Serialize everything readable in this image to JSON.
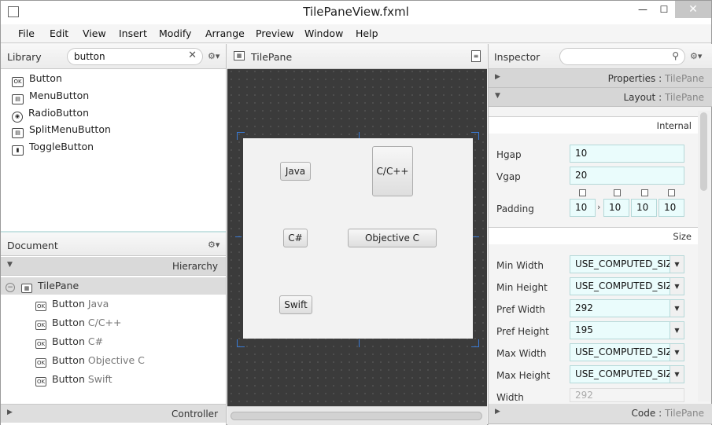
{
  "window": {
    "title": "TilePaneView.fxml",
    "min": "—",
    "max": "☐",
    "close": "✕"
  },
  "menu": [
    "File",
    "Edit",
    "View",
    "Insert",
    "Modify",
    "Arrange",
    "Preview",
    "Window",
    "Help"
  ],
  "library": {
    "title": "Library",
    "search_value": "button",
    "items": [
      {
        "icon": "OK",
        "label": "Button"
      },
      {
        "icon": "▤",
        "label": "MenuButton"
      },
      {
        "icon": "◉",
        "label": "RadioButton"
      },
      {
        "icon": "▤",
        "label": "SplitMenuButton"
      },
      {
        "icon": "▮",
        "label": "ToggleButton"
      }
    ]
  },
  "document": {
    "title": "Document",
    "hierarchy_label": "Hierarchy",
    "root": "TilePane",
    "children": [
      {
        "type": "Button",
        "text": "Java"
      },
      {
        "type": "Button",
        "text": "C/C++"
      },
      {
        "type": "Button",
        "text": "C#"
      },
      {
        "type": "Button",
        "text": "Objective C"
      },
      {
        "type": "Button",
        "text": "Swift"
      }
    ],
    "controller_label": "Controller"
  },
  "canvas": {
    "header": "TilePane",
    "buttons": {
      "java": "Java",
      "cpp": "C/C++",
      "cs": "C#",
      "objc": "Objective C",
      "swift": "Swift"
    }
  },
  "inspector": {
    "title": "Inspector",
    "search_placeholder": "",
    "properties": {
      "name": "Properties",
      "target": "TilePane"
    },
    "layout": {
      "name": "Layout",
      "target": "TilePane"
    },
    "code": {
      "name": "Code",
      "target": "TilePane"
    },
    "internal_label": "Internal",
    "size_label": "Size",
    "hgap": {
      "label": "Hgap",
      "value": "10"
    },
    "vgap": {
      "label": "Vgap",
      "value": "20"
    },
    "padding": {
      "label": "Padding",
      "values": [
        "10",
        "10",
        "10",
        "10"
      ]
    },
    "min_width": {
      "label": "Min Width",
      "value": "USE_COMPUTED_SIZE"
    },
    "min_height": {
      "label": "Min Height",
      "value": "USE_COMPUTED_SIZE"
    },
    "pref_width": {
      "label": "Pref Width",
      "value": "292"
    },
    "pref_height": {
      "label": "Pref Height",
      "value": "195"
    },
    "max_width": {
      "label": "Max Width",
      "value": "USE_COMPUTED_SIZE"
    },
    "max_height": {
      "label": "Max Height",
      "value": "USE_COMPUTED_SIZE"
    },
    "width": {
      "label": "Width",
      "value": "292"
    },
    "colon": ":"
  }
}
